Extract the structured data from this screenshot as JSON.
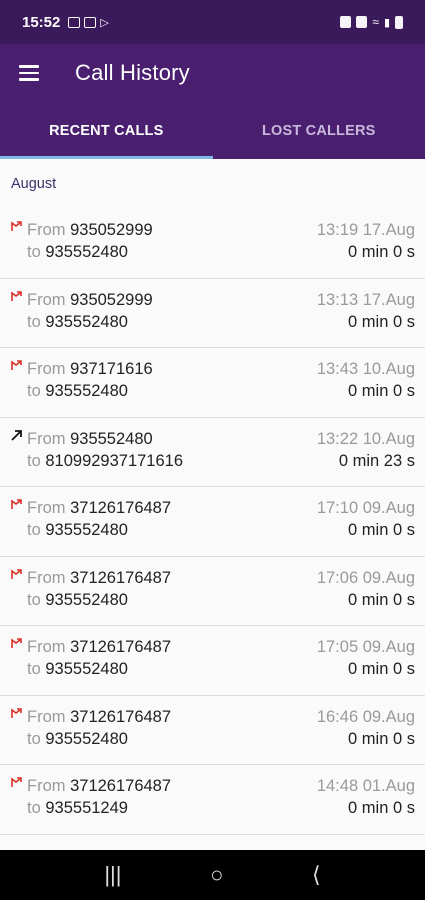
{
  "status": {
    "time": "15:52"
  },
  "app_bar": {
    "title": "Call History"
  },
  "tabs": [
    {
      "label": "RECENT CALLS",
      "active": true
    },
    {
      "label": "LOST CALLERS",
      "active": false
    }
  ],
  "section": "August",
  "labels": {
    "from": "From",
    "to": "to"
  },
  "calls": [
    {
      "icon": "missed-call-icon",
      "from": "935052999",
      "to": "935552480",
      "time": "13:19 17.Aug",
      "duration": "0 min 0 s"
    },
    {
      "icon": "missed-call-icon",
      "from": "935052999",
      "to": "935552480",
      "time": "13:13 17.Aug",
      "duration": "0 min 0 s"
    },
    {
      "icon": "missed-call-icon",
      "from": "937171616",
      "to": "935552480",
      "time": "13:43 10.Aug",
      "duration": "0 min 0 s"
    },
    {
      "icon": "outgoing-call-icon",
      "from": "935552480",
      "to": "810992937171616",
      "time": "13:22 10.Aug",
      "duration": "0 min 23 s"
    },
    {
      "icon": "missed-call-icon",
      "from": "37126176487",
      "to": "935552480",
      "time": "17:10 09.Aug",
      "duration": "0 min 0 s"
    },
    {
      "icon": "missed-call-icon",
      "from": "37126176487",
      "to": "935552480",
      "time": "17:06 09.Aug",
      "duration": "0 min 0 s"
    },
    {
      "icon": "missed-call-icon",
      "from": "37126176487",
      "to": "935552480",
      "time": "17:05 09.Aug",
      "duration": "0 min 0 s"
    },
    {
      "icon": "missed-call-icon",
      "from": "37126176487",
      "to": "935552480",
      "time": "16:46 09.Aug",
      "duration": "0 min 0 s"
    },
    {
      "icon": "missed-call-icon",
      "from": "37126176487",
      "to": "935551249",
      "time": "14:48 01.Aug",
      "duration": "0 min 0 s"
    }
  ],
  "colors": {
    "status_bar": "#3b1a5c",
    "app_bar": "#4a1f70",
    "tab_indicator": "#7fb8e6",
    "missed_icon": "#d93025"
  }
}
